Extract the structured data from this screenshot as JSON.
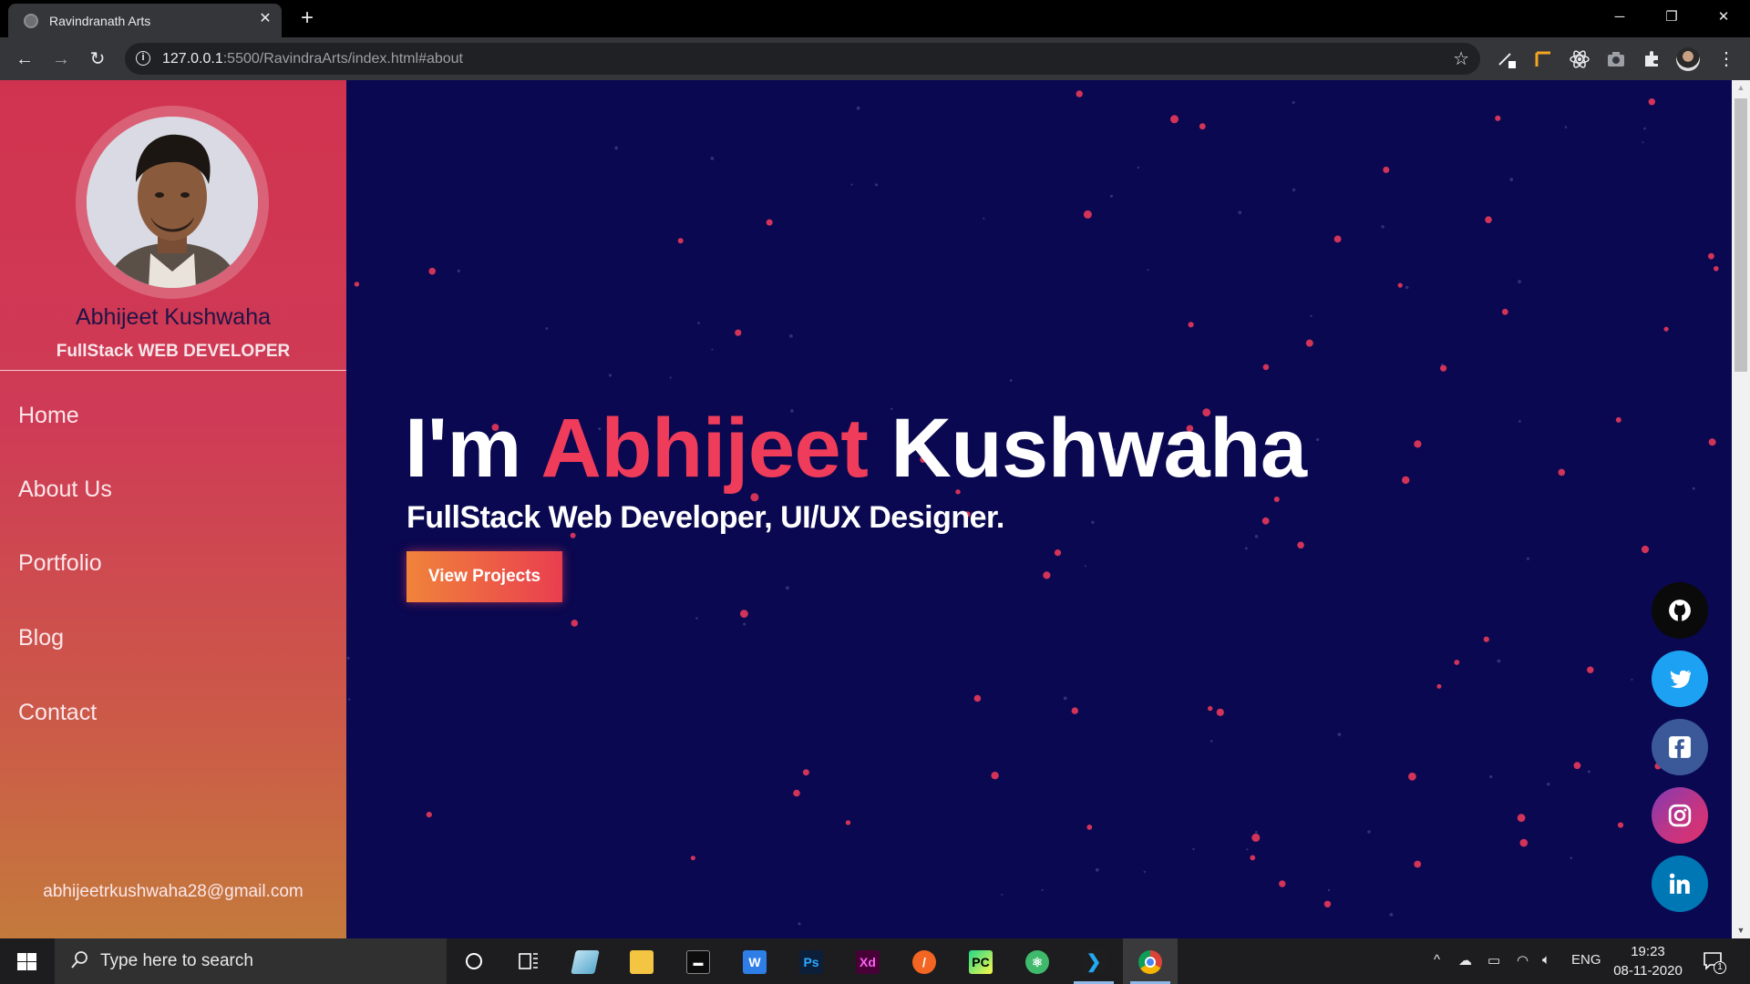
{
  "browser": {
    "tab_title": "Ravindranath Arts",
    "url_host": "127.0.0.1",
    "url_rest": ":5500/RavindraArts/index.html#about"
  },
  "sidebar": {
    "name": "Abhijeet Kushwaha",
    "role": "FullStack WEB DEVELOPER",
    "nav": [
      "Home",
      "About Us",
      "Portfolio",
      "Blog",
      "Contact"
    ],
    "email": "abhijeetrkushwaha28@gmail.com"
  },
  "hero": {
    "prefix": "I'm",
    "first_name": "Abhijeet",
    "last_name": "Kushwaha",
    "subtitle": "FullStack Web Developer, UI/UX Designer.",
    "cta": "View Projects"
  },
  "social": [
    {
      "icon": "github-icon",
      "color": "#0a0a0a"
    },
    {
      "icon": "twitter-icon",
      "color": "#1da1f2"
    },
    {
      "icon": "facebook-icon",
      "color": "#3b5998"
    },
    {
      "icon": "instagram-icon",
      "color": "#c13584"
    },
    {
      "icon": "linkedin-icon",
      "color": "#0077b5"
    }
  ],
  "colors": {
    "page_bg": "#0a0850",
    "accent": "#ef3c5a",
    "sidebar_top": "#d0334f",
    "sidebar_bottom": "#c47a3c"
  },
  "taskbar": {
    "search_placeholder": "Type here to search",
    "language": "ENG",
    "time": "19:23",
    "date": "08-11-2020",
    "notification_count": "1"
  }
}
